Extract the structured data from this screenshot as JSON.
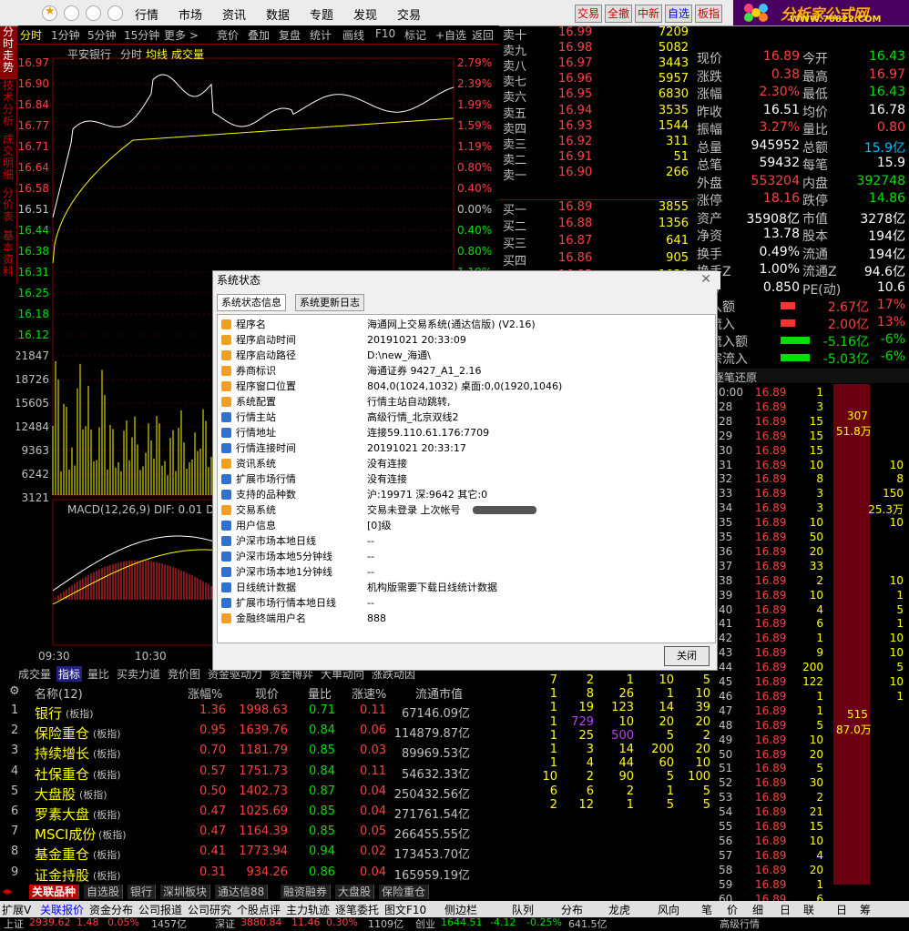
{
  "menubar": {
    "items": [
      "行情",
      "市场",
      "资讯",
      "数据",
      "专题",
      "发现",
      "交易"
    ],
    "quick": [
      "交易",
      "全撤",
      "中新",
      "自选",
      "板指"
    ],
    "logo_text": "分析家公式网",
    "logo_url": "WWW.70822.COM"
  },
  "sidetabs": [
    "分时走势",
    "技术分析",
    "成交明细",
    "分价表",
    "基本资料"
  ],
  "toolbar": {
    "items": [
      "分时",
      "1分钟",
      "5分钟",
      "15分钟",
      "更多 >",
      "竞价",
      "叠加",
      "复盘",
      "统计",
      "画线",
      "F10",
      "标记",
      "+自选",
      "返回"
    ]
  },
  "chart": {
    "stock": "平安银行",
    "mode": "分时",
    "avg_label": "均线",
    "vol_label": "成交量",
    "price_ticks": [
      "16.97",
      "16.90",
      "16.84",
      "16.77",
      "16.71",
      "16.64",
      "16.58",
      "16.51",
      "16.44",
      "16.38",
      "16.31",
      "16.25",
      "16.18",
      "16.12"
    ],
    "pct_ticks": [
      "2.79%",
      "2.39%",
      "1.99%",
      "1.59%",
      "1.19%",
      "0.80%",
      "0.40%",
      "0.00%",
      "0.40%",
      "0.80%",
      "1.19%"
    ],
    "vol_ticks": [
      "21847",
      "18726",
      "15605",
      "12484",
      "9363",
      "6242",
      "3121"
    ],
    "macd_label": "MACD(12,26,9) DIF: 0.01 DE",
    "time_ticks": [
      "09:30",
      "10:30"
    ]
  },
  "orderbook": {
    "asks": [
      {
        "l": "卖十",
        "p": "16.99",
        "v": "7209"
      },
      {
        "l": "卖九",
        "p": "16.98",
        "v": "5082"
      },
      {
        "l": "卖八",
        "p": "16.97",
        "v": "3443"
      },
      {
        "l": "卖七",
        "p": "16.96",
        "v": "5957"
      },
      {
        "l": "卖六",
        "p": "16.95",
        "v": "6830"
      },
      {
        "l": "卖五",
        "p": "16.94",
        "v": "3535"
      },
      {
        "l": "卖四",
        "p": "16.93",
        "v": "1544"
      },
      {
        "l": "卖三",
        "p": "16.92",
        "v": "311"
      },
      {
        "l": "卖二",
        "p": "16.91",
        "v": "51"
      },
      {
        "l": "卖一",
        "p": "16.90",
        "v": "266"
      }
    ],
    "bids": [
      {
        "l": "买一",
        "p": "16.89",
        "v": "3855"
      },
      {
        "l": "买二",
        "p": "16.88",
        "v": "1356"
      },
      {
        "l": "买三",
        "p": "16.87",
        "v": "641"
      },
      {
        "l": "买四",
        "p": "16.86",
        "v": "905"
      },
      {
        "l": "买五",
        "p": "16.85",
        "v": "1020"
      }
    ]
  },
  "quote": {
    "rows": [
      {
        "a": "现价",
        "av": "16.89",
        "b": "今开",
        "bv": "16.43"
      },
      {
        "a": "涨跌",
        "av": "0.38",
        "b": "最高",
        "bv": "16.97"
      },
      {
        "a": "涨幅",
        "av": "2.30%",
        "b": "最低",
        "bv": "16.43"
      },
      {
        "a": "昨收",
        "av": "16.51",
        "b": "均价",
        "bv": "16.78"
      },
      {
        "a": "振幅",
        "av": "3.27%",
        "b": "量比",
        "bv": "0.80"
      },
      {
        "a": "总量",
        "av": "945952",
        "b": "总额",
        "bv": "15.9亿"
      },
      {
        "a": "总笔",
        "av": "59432",
        "b": "每笔",
        "bv": "15.9"
      },
      {
        "a": "外盘",
        "av": "553204",
        "b": "内盘",
        "bv": "392748"
      },
      {
        "a": "涨停",
        "av": "18.16",
        "b": "跌停",
        "bv": "14.86"
      },
      {
        "a": "资产",
        "av": "35908亿",
        "b": "市值",
        "bv": "3278亿"
      },
      {
        "a": "净资",
        "av": "13.78",
        "b": "股本",
        "bv": "194亿"
      },
      {
        "a": "换手",
        "av": "0.49%",
        "b": "流通",
        "bv": "194亿"
      },
      {
        "a": "换手Z",
        "av": "1.00%",
        "b": "流通Z",
        "bv": "94.6亿"
      },
      {
        "a": "(二)",
        "av": "0.850",
        "b": "PE(动)",
        "bv": "10.6"
      }
    ],
    "flows": [
      {
        "l": "流入额",
        "v": "2.67亿",
        "p": "17%"
      },
      {
        "l": "宗流入",
        "v": "2.00亿",
        "p": "13%"
      },
      {
        "l": "净流入额",
        "v": "-5.16亿",
        "p": "-6%"
      },
      {
        "l": "大宗流入",
        "v": "-5.03亿",
        "p": "-6%"
      }
    ],
    "ticks_title": "逐笔还原"
  },
  "ticks": [
    {
      "t": "0:00",
      "p": "16.89",
      "v": "1"
    },
    {
      "t": "28",
      "p": "16.89",
      "v": "3"
    },
    {
      "t": "28",
      "p": "16.89",
      "v": "15"
    },
    {
      "t": "29",
      "p": "16.89",
      "v": "15"
    },
    {
      "t": "30",
      "p": "16.89",
      "v": "15"
    },
    {
      "t": "31",
      "p": "16.89",
      "v": "10"
    },
    {
      "t": "32",
      "p": "16.89",
      "v": "8"
    },
    {
      "t": "33",
      "p": "16.89",
      "v": "3"
    },
    {
      "t": "34",
      "p": "16.89",
      "v": "3"
    },
    {
      "t": "35",
      "p": "16.89",
      "v": "10"
    },
    {
      "t": "35",
      "p": "16.89",
      "v": "50"
    },
    {
      "t": "36",
      "p": "16.89",
      "v": "20"
    },
    {
      "t": "37",
      "p": "16.89",
      "v": "33"
    },
    {
      "t": "38",
      "p": "16.89",
      "v": "2"
    },
    {
      "t": "39",
      "p": "16.89",
      "v": "10"
    },
    {
      "t": "40",
      "p": "16.89",
      "v": "4"
    },
    {
      "t": "41",
      "p": "16.89",
      "v": "6"
    },
    {
      "t": "42",
      "p": "16.89",
      "v": "1"
    },
    {
      "t": "43",
      "p": "16.89",
      "v": "9"
    },
    {
      "t": "44",
      "p": "16.89",
      "v": "200"
    },
    {
      "t": "45",
      "p": "16.89",
      "v": "122"
    },
    {
      "t": "46",
      "p": "16.89",
      "v": "1"
    },
    {
      "t": "47",
      "p": "16.89",
      "v": "1"
    },
    {
      "t": "48",
      "p": "16.89",
      "v": "5"
    },
    {
      "t": "49",
      "p": "16.89",
      "v": "10"
    },
    {
      "t": "50",
      "p": "16.89",
      "v": "20"
    },
    {
      "t": "51",
      "p": "16.89",
      "v": "5"
    },
    {
      "t": "52",
      "p": "16.89",
      "v": "30"
    },
    {
      "t": "53",
      "p": "16.89",
      "v": "2"
    },
    {
      "t": "54",
      "p": "16.89",
      "v": "21"
    },
    {
      "t": "55",
      "p": "16.89",
      "v": "15"
    },
    {
      "t": "56",
      "p": "16.89",
      "v": "10"
    },
    {
      "t": "57",
      "p": "16.89",
      "v": "4"
    },
    {
      "t": "58",
      "p": "16.89",
      "v": "20"
    },
    {
      "t": "59",
      "p": "16.89",
      "v": "1"
    },
    {
      "t": "60",
      "p": "16.89",
      "v": "6"
    }
  ],
  "tick_side": [
    {
      "v": "307",
      "x": "51.8万"
    },
    {
      "v": "515",
      "x": "87.0万"
    }
  ],
  "tick_right": [
    "10",
    "8",
    "150",
    "25.3万",
    "10",
    "10",
    "1",
    "5",
    "1",
    "10",
    "10",
    "5",
    "10",
    "1"
  ],
  "dialog": {
    "title": "系统状态",
    "tabs": [
      "系统状态信息",
      "系统更新日志"
    ],
    "close": "关闭",
    "rows": [
      {
        "k": "程序名",
        "v": "海通网上交易系统(通达信版) (V2.16)",
        "c": "o"
      },
      {
        "k": "程序启动时间",
        "v": "20191021 20:33:09",
        "c": "o"
      },
      {
        "k": "程序启动路径",
        "v": "D:\\new_海通\\",
        "c": "o"
      },
      {
        "k": "券商标识",
        "v": "海通证券 9427_A1_2.16",
        "c": "o"
      },
      {
        "k": "程序窗口位置",
        "v": "804,0(1024,1032) 桌面:0,0(1920,1046)",
        "c": "o"
      },
      {
        "k": "系统配置",
        "v": "行情主站自动跳转,",
        "c": "o"
      },
      {
        "k": "行情主站",
        "v": "高级行情_北京双线2",
        "c": "b"
      },
      {
        "k": "行情地址",
        "v": "连接59.110.61.176:7709",
        "c": "b"
      },
      {
        "k": "行情连接时间",
        "v": "20191021 20:33:17",
        "c": "b"
      },
      {
        "k": "资讯系统",
        "v": "没有连接",
        "c": "o"
      },
      {
        "k": "扩展市场行情",
        "v": "没有连接",
        "c": "b"
      },
      {
        "k": "支持的品种数",
        "v": "沪:19971 深:9642 其它:0",
        "c": "b"
      },
      {
        "k": "交易系统",
        "v": "交易未登录 上次帐号",
        "c": "o"
      },
      {
        "k": "用户信息",
        "v": "[0]级",
        "c": "b"
      },
      {
        "k": "沪深市场本地日线",
        "v": "--",
        "c": "b"
      },
      {
        "k": "沪深市场本地5分钟线",
        "v": "--",
        "c": "b"
      },
      {
        "k": "沪深市场本地1分钟线",
        "v": "--",
        "c": "b"
      },
      {
        "k": "日线统计数据",
        "v": "机构版需要下载日线统计数据",
        "c": "b"
      },
      {
        "k": "扩展市场行情本地日线",
        "v": "--",
        "c": "b"
      },
      {
        "k": "金融终端用户名",
        "v": "888",
        "c": "o"
      }
    ]
  },
  "bottomtabs": [
    "成交量",
    "指标",
    "量比",
    "买卖力道",
    "竞价图",
    "资金驱动力",
    "资金博弈",
    "大单动向",
    "涨跌动因"
  ],
  "table": {
    "headers": [
      "名称(12)",
      "涨幅%",
      "现价",
      "量比",
      "涨速%",
      "流通市值"
    ],
    "rows": [
      {
        "n": "1",
        "name": "银行",
        "tag": "(板指)",
        "chg": "1.36",
        "price": "1998.63",
        "lb": "0.71",
        "spd": "0.11",
        "mv": "67146.09亿"
      },
      {
        "n": "2",
        "name": "保险重仓",
        "tag": "(板指)",
        "chg": "0.95",
        "price": "1639.76",
        "lb": "0.84",
        "spd": "0.06",
        "mv": "114879.87亿"
      },
      {
        "n": "3",
        "name": "持续增长",
        "tag": "(板指)",
        "chg": "0.70",
        "price": "1181.79",
        "lb": "0.85",
        "spd": "0.03",
        "mv": "89969.53亿"
      },
      {
        "n": "4",
        "name": "社保重仓",
        "tag": "(板指)",
        "chg": "0.57",
        "price": "1751.73",
        "lb": "0.84",
        "spd": "0.11",
        "mv": "54632.33亿"
      },
      {
        "n": "5",
        "name": "大盘股",
        "tag": "(板指)",
        "chg": "0.50",
        "price": "1402.73",
        "lb": "0.87",
        "spd": "0.04",
        "mv": "250432.56亿"
      },
      {
        "n": "6",
        "name": "罗素大盘",
        "tag": "(板指)",
        "chg": "0.47",
        "price": "1025.69",
        "lb": "0.85",
        "spd": "0.04",
        "mv": "271761.54亿"
      },
      {
        "n": "7",
        "name": "MSCI成份",
        "tag": "(板指)",
        "chg": "0.47",
        "price": "1164.39",
        "lb": "0.85",
        "spd": "0.05",
        "mv": "266455.55亿"
      },
      {
        "n": "8",
        "name": "基金重仓",
        "tag": "(板指)",
        "chg": "0.41",
        "price": "1773.94",
        "lb": "0.94",
        "spd": "0.02",
        "mv": "173453.70亿"
      },
      {
        "n": "9",
        "name": "证金持股",
        "tag": "(板指)",
        "chg": "0.31",
        "price": "934.26",
        "lb": "0.86",
        "spd": "0.04",
        "mv": "165959.19亿"
      }
    ]
  },
  "midgrid": [
    [
      "7",
      "2",
      "1",
      "10",
      "5"
    ],
    [
      "1",
      "8",
      "26",
      "1",
      "10"
    ],
    [
      "1",
      "19",
      "123",
      "14",
      "39"
    ],
    [
      "1",
      "729",
      "10",
      "20",
      "20"
    ],
    [
      "1",
      "25",
      "500",
      "5",
      "2"
    ],
    [
      "1",
      "3",
      "14",
      "200",
      "20"
    ],
    [
      "1",
      "4",
      "44",
      "60",
      "10"
    ],
    [
      "10",
      "2",
      "90",
      "5",
      "100"
    ],
    [
      "6",
      "6",
      "2",
      "1",
      "5"
    ],
    [
      "2",
      "12",
      "1",
      "5",
      "5"
    ]
  ],
  "footer_tabs": [
    "关联品种",
    "自选股",
    "银行",
    "深圳板块",
    "通达信88",
    "融资融券",
    "大盘股",
    "保险重仓"
  ],
  "footer2": [
    "扩展V",
    "关联报价",
    "资金分布",
    "公司报道",
    "公司研究",
    "个股点评",
    "主力轨迹",
    "逐笔委托",
    "图文F10",
    "侧边栏"
  ],
  "footer2_right": [
    "队列",
    "分布",
    "龙虎",
    "风向",
    "笔",
    "价",
    "细",
    "日",
    "联",
    "日",
    "筹"
  ],
  "statusbar": {
    "sh": "上证",
    "sh_v": "2939.62",
    "sh_c": "1.48",
    "sh_p": "0.05%",
    "sh_a": "1457亿",
    "sz": "深证",
    "sz_v": "3880.84",
    "sz_c": "11.46",
    "sz_p": "0.30%",
    "sz_a": "1109亿",
    "cy": "创业",
    "cy_v": "1644.51",
    "cy_c": "-4.12",
    "cy_p": "-0.25%",
    "cy_a": "641.5亿",
    "hq": "高级行情"
  },
  "colors": {
    "red": "#ff4040",
    "green": "#00e000",
    "yellow": "#ffff00",
    "up": "#ff3232",
    "bg": "#000000"
  }
}
